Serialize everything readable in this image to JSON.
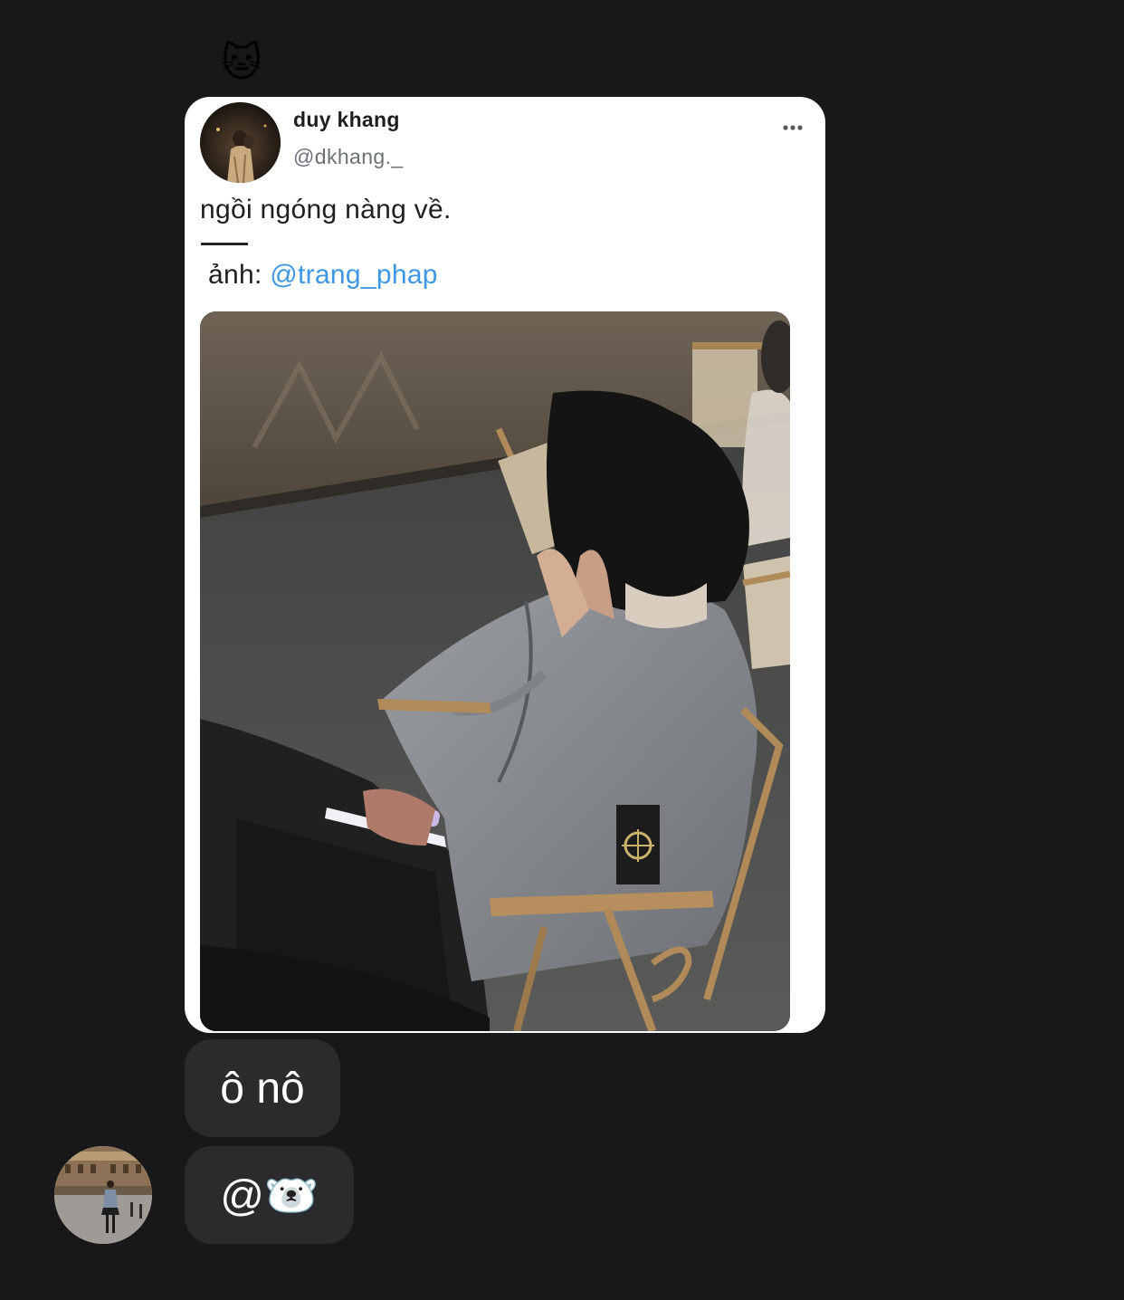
{
  "reaction": {
    "emoji": "🐱",
    "icon": "cat-face-icon"
  },
  "shared_post": {
    "author_name": "duy khang",
    "author_handle": "@dkhang._",
    "text": "ngồi ngóng nàng về.",
    "credit_prefix": "ảnh: ",
    "credit_mention": "@trang_phap",
    "more_icon": "more-horizontal-icon",
    "mention_color": "#3d97e3"
  },
  "messages": [
    {
      "text": "ô nô"
    },
    {
      "text": "@🐻‍❄️"
    }
  ],
  "colors": {
    "background": "#18181b",
    "bubble": "#2b2b2e",
    "card": "#ffffff"
  }
}
